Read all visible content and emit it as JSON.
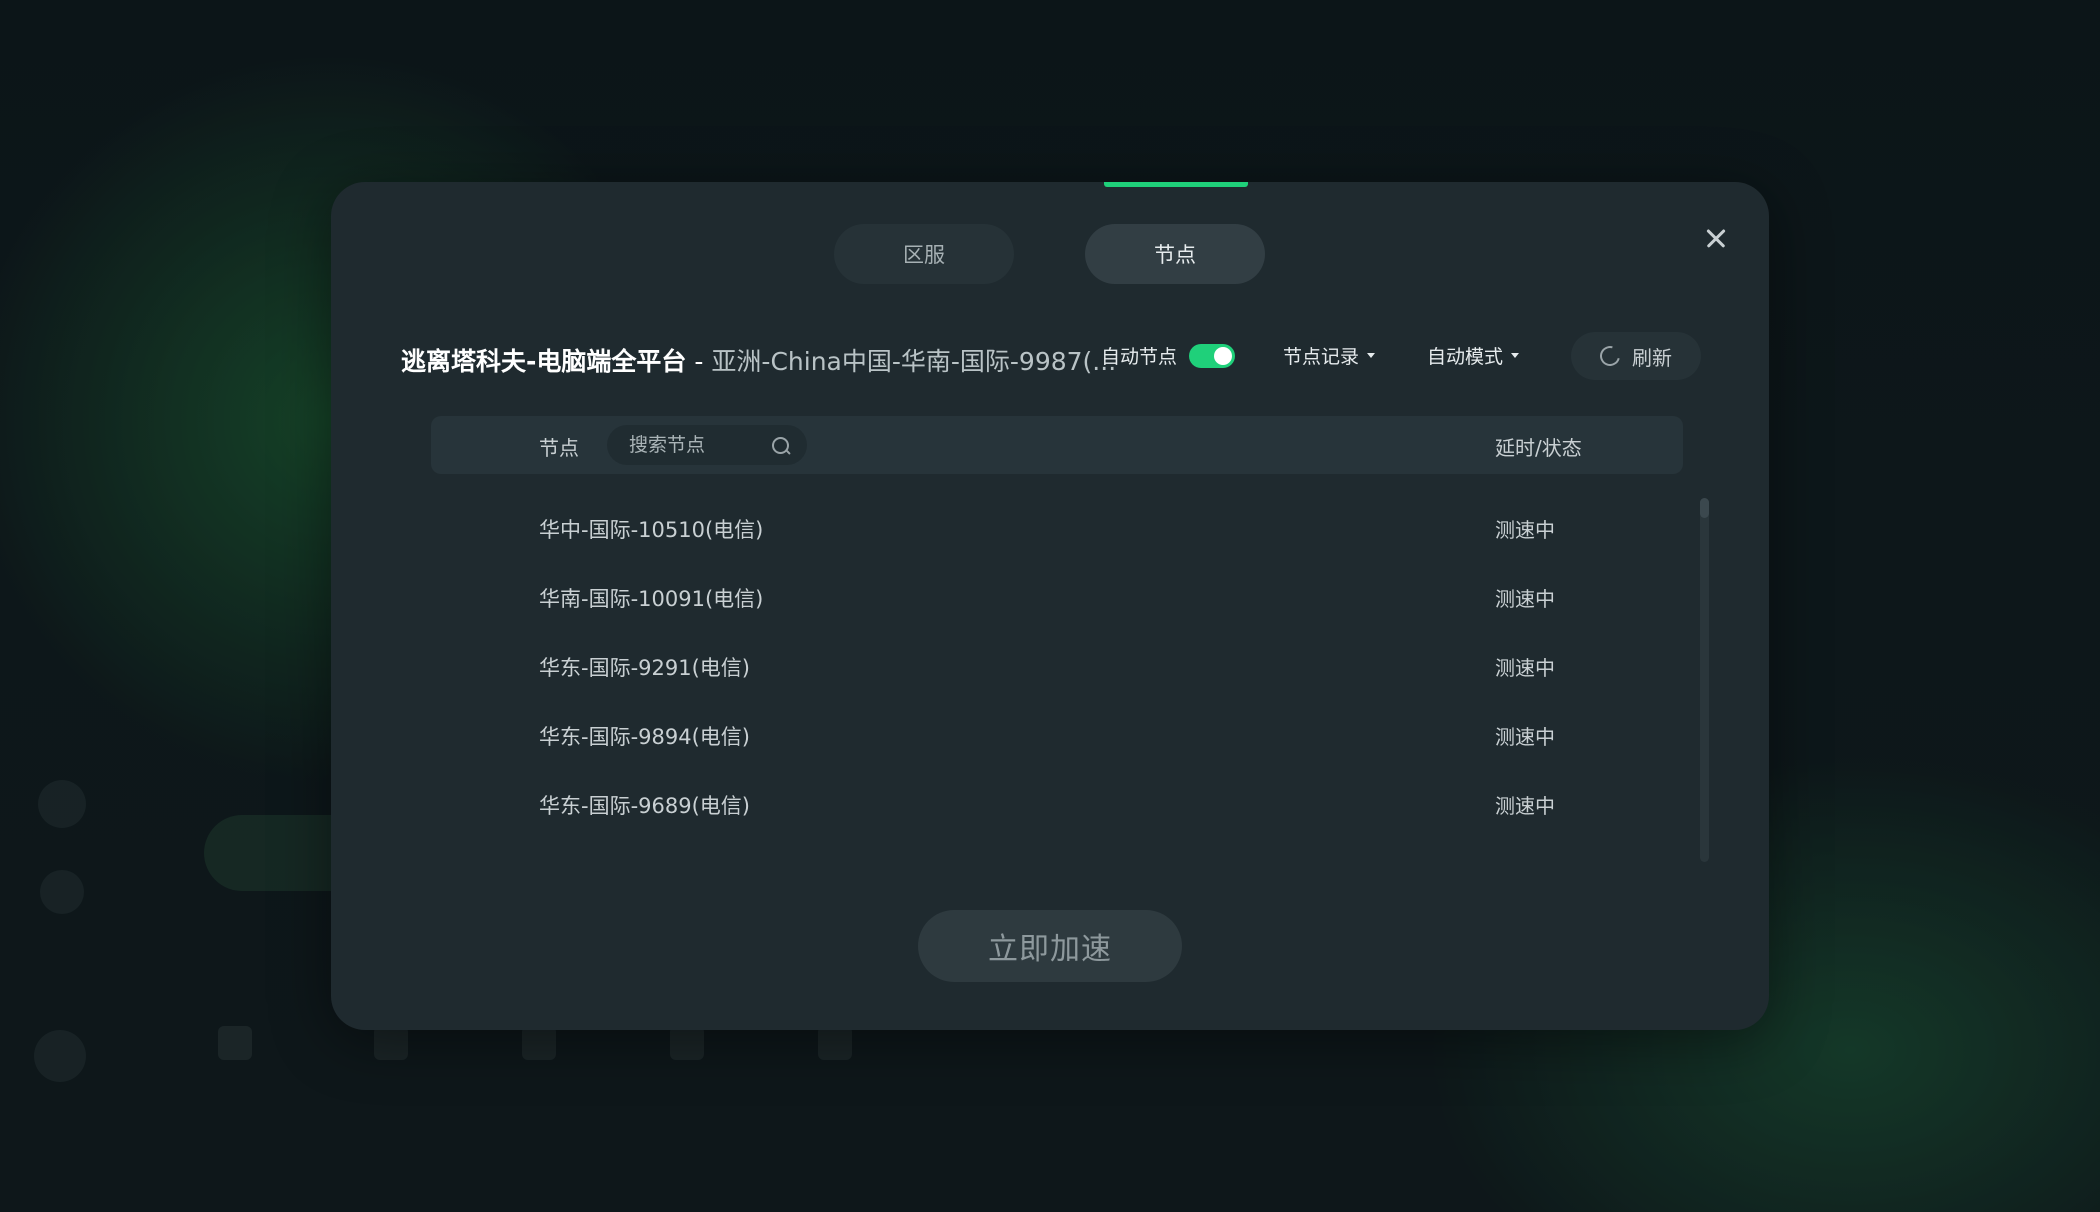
{
  "tabs": [
    {
      "label": "区服",
      "active": false
    },
    {
      "label": "节点",
      "active": true
    }
  ],
  "header": {
    "game_name": "逃离塔科夫-电脑端全平台",
    "separator": "-",
    "route": "亚洲-China中国-华南-国际-9987(..."
  },
  "controls": {
    "auto_node_label": "自动节点",
    "auto_node_enabled": true,
    "node_record_label": "节点记录",
    "auto_mode_label": "自动模式",
    "refresh_label": "刷新"
  },
  "table": {
    "col_node": "节点",
    "search_placeholder": "搜索节点",
    "col_latency": "延时/状态",
    "rows": [
      {
        "name": "华中-国际-10510(电信)",
        "status": "测速中"
      },
      {
        "name": "华南-国际-10091(电信)",
        "status": "测速中"
      },
      {
        "name": "华东-国际-9291(电信)",
        "status": "测速中"
      },
      {
        "name": "华东-国际-9894(电信)",
        "status": "测速中"
      },
      {
        "name": "华东-国际-9689(电信)",
        "status": "测速中"
      }
    ]
  },
  "actions": {
    "accelerate_label": "立即加速"
  },
  "colors": {
    "accent": "#1fd07a",
    "modal_bg": "#1f2a2f",
    "text_primary": "#ffffff",
    "text_secondary": "#c9d0d3"
  }
}
